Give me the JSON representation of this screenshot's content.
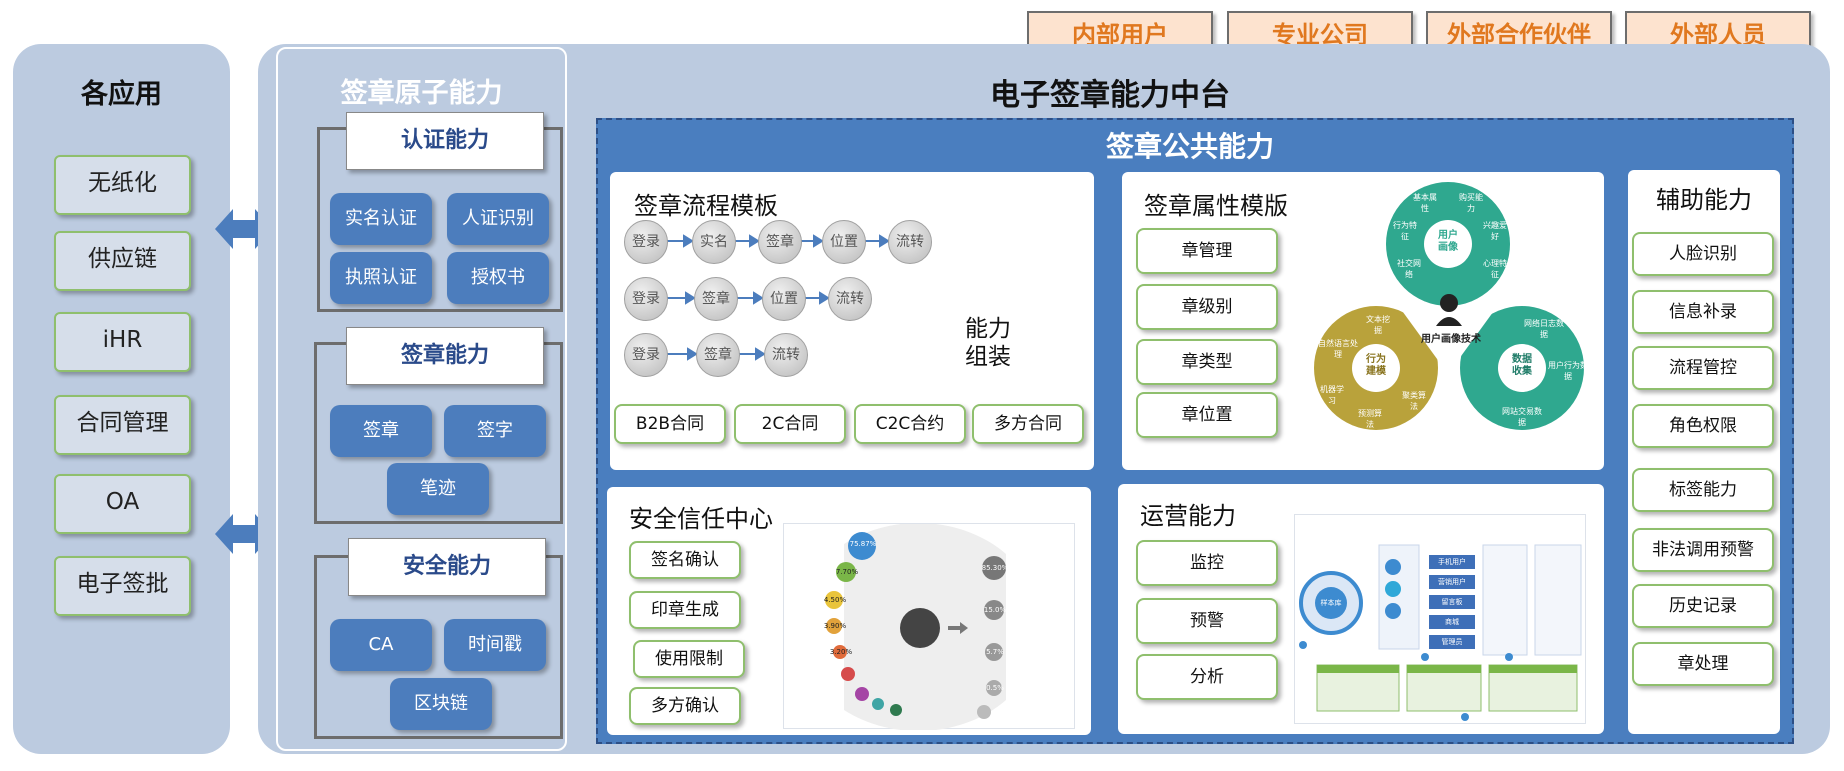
{
  "user_tabs": [
    "内部用户",
    "专业公司",
    "外部合作伙伴",
    "外部人员"
  ],
  "apps": {
    "title": "各应用",
    "items": [
      "无纸化",
      "供应链",
      "iHR",
      "合同管理",
      "OA",
      "电子签批"
    ]
  },
  "atomic": {
    "title": "签章原子能力",
    "auth": {
      "title": "认证能力",
      "items": [
        "实名认证",
        "人证识别",
        "执照认证",
        "授权书"
      ]
    },
    "sign": {
      "title": "签章能力",
      "items": [
        "签章",
        "签字",
        "笔迹"
      ]
    },
    "security": {
      "title": "安全能力",
      "items": [
        "CA",
        "时间戳",
        "区块链"
      ]
    }
  },
  "platform_title": "电子签章能力中台",
  "public_title": "签章公共能力",
  "process": {
    "title": "签章流程模板",
    "rows": [
      [
        "登录",
        "实名",
        "签章",
        "位置",
        "流转"
      ],
      [
        "登录",
        "签章",
        "位置",
        "流转"
      ],
      [
        "登录",
        "签章",
        "流转"
      ]
    ],
    "assembly_line1": "能力",
    "assembly_line2": "组装",
    "contracts": [
      "B2B合同",
      "2C合同",
      "C2C合约",
      "多方合同"
    ]
  },
  "attr": {
    "title": "签章属性模版",
    "items": [
      "章管理",
      "章级别",
      "章类型",
      "章位置"
    ],
    "diagram": {
      "center": "用户画像技术",
      "top": "用户画像",
      "left": "行为建模",
      "right": "数据收集",
      "top_petals": [
        "基本属性",
        "购买能力",
        "兴趣爱好",
        "心理特征",
        "社交网络",
        "行为特征"
      ],
      "left_petals": [
        "文本挖掘",
        "自然语言处理",
        "机器学习",
        "预测算法",
        "聚类算法"
      ],
      "right_petals": [
        "网络日志数据",
        "用户行为数据",
        "网站交易数据"
      ]
    }
  },
  "aux": {
    "title": "辅助能力",
    "items": [
      "人脸识别",
      "信息补录",
      "流程管控",
      "角色权限",
      "标签能力",
      "非法调用预警",
      "历史记录",
      "章处理"
    ]
  },
  "trust": {
    "title": "安全信任中心",
    "items": [
      "签名确认",
      "印章生成",
      "使用限制",
      "多方确认"
    ],
    "left_values": [
      "75.87%",
      "7.70%",
      "4.50%",
      "3.90%",
      "3.20%"
    ],
    "right_values": [
      "85.30%",
      "15.0%",
      "5.7%",
      "0.5%"
    ]
  },
  "ops": {
    "title": "运营能力",
    "items": [
      "监控",
      "预警",
      "分析"
    ],
    "dash_labels": [
      "样本库",
      "手机用户",
      "营销用户",
      "留言板",
      "商城",
      "管理员"
    ]
  },
  "colors": {
    "grey_panel": "#bccbe0",
    "blue_panel": "#4a7ebf",
    "blue_button": "#4c7dbd",
    "green_border": "#8fbf6d",
    "orange_text": "#e0781f",
    "orange_fill": "#fde3cf",
    "teal": "#2fa88f",
    "olive": "#b9a23b"
  },
  "icons": [
    "double-arrow-icon",
    "user-profile-icon"
  ]
}
